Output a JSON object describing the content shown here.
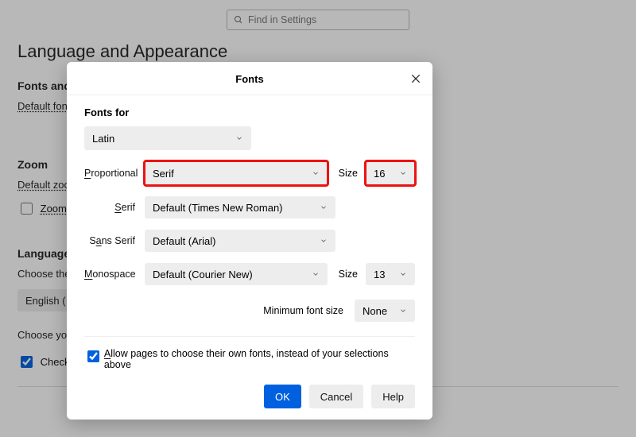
{
  "search": {
    "placeholder": "Find in Settings"
  },
  "page": {
    "title": "Language and Appearance",
    "fonts_section": "Fonts and Colors",
    "default_font_label": "Default font",
    "zoom_section": "Zoom",
    "default_zoom_label": "Default zoom",
    "zoom_text_only": "Zoom text only",
    "language_section": "Language",
    "choose_lang_label": "Choose the language",
    "language_value": "English (",
    "choose_your": "Choose your",
    "spellcheck": "Check your spelling as you type"
  },
  "dialog": {
    "title": "Fonts",
    "fonts_for": "Fonts for",
    "script": "Latin",
    "labels": {
      "proportional": "Proportional",
      "serif": "Serif",
      "sans": "Sans Serif",
      "mono": "Monospace",
      "size": "Size",
      "min_size": "Minimum font size"
    },
    "values": {
      "proportional": "Serif",
      "proportional_size": "16",
      "serif": "Default (Times New Roman)",
      "sans": "Default (Arial)",
      "mono": "Default (Courier New)",
      "mono_size": "13",
      "min_size": "None"
    },
    "allow_pages": "Allow pages to choose their own fonts, instead of your selections above",
    "buttons": {
      "ok": "OK",
      "cancel": "Cancel",
      "help": "Help"
    }
  }
}
